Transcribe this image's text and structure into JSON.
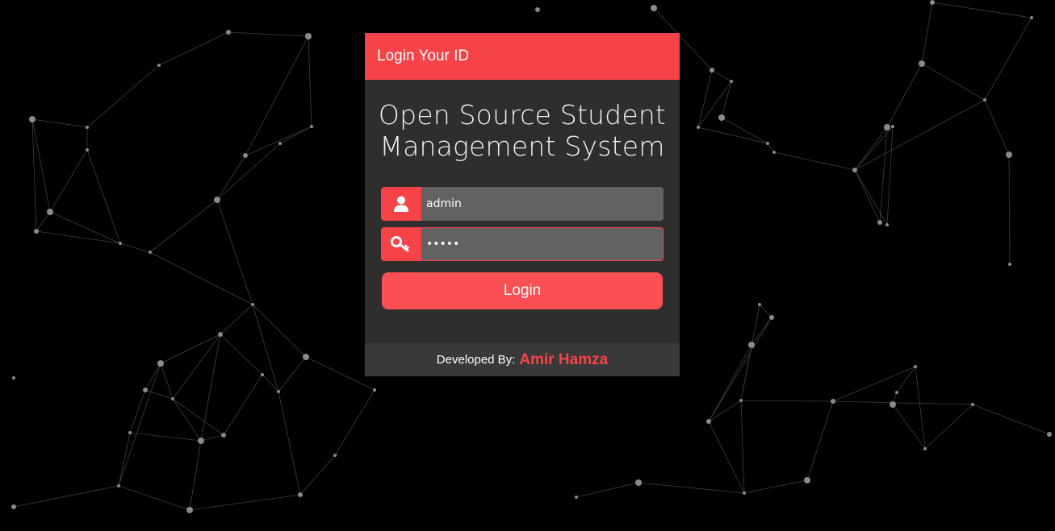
{
  "header": {
    "title": "Login Your ID"
  },
  "app": {
    "title_line1": "Open Source Student",
    "title_line2": "Management System"
  },
  "form": {
    "username_value": "admin",
    "username_icon": "user-icon",
    "password_value": "admin",
    "password_icon": "key-icon",
    "login_label": "Login"
  },
  "footer": {
    "label": "Developed By:",
    "author": "Amir Hamza"
  },
  "colors": {
    "accent": "#f64348",
    "panel": "#2f2e2e",
    "input": "#646162",
    "background": "#000000"
  }
}
